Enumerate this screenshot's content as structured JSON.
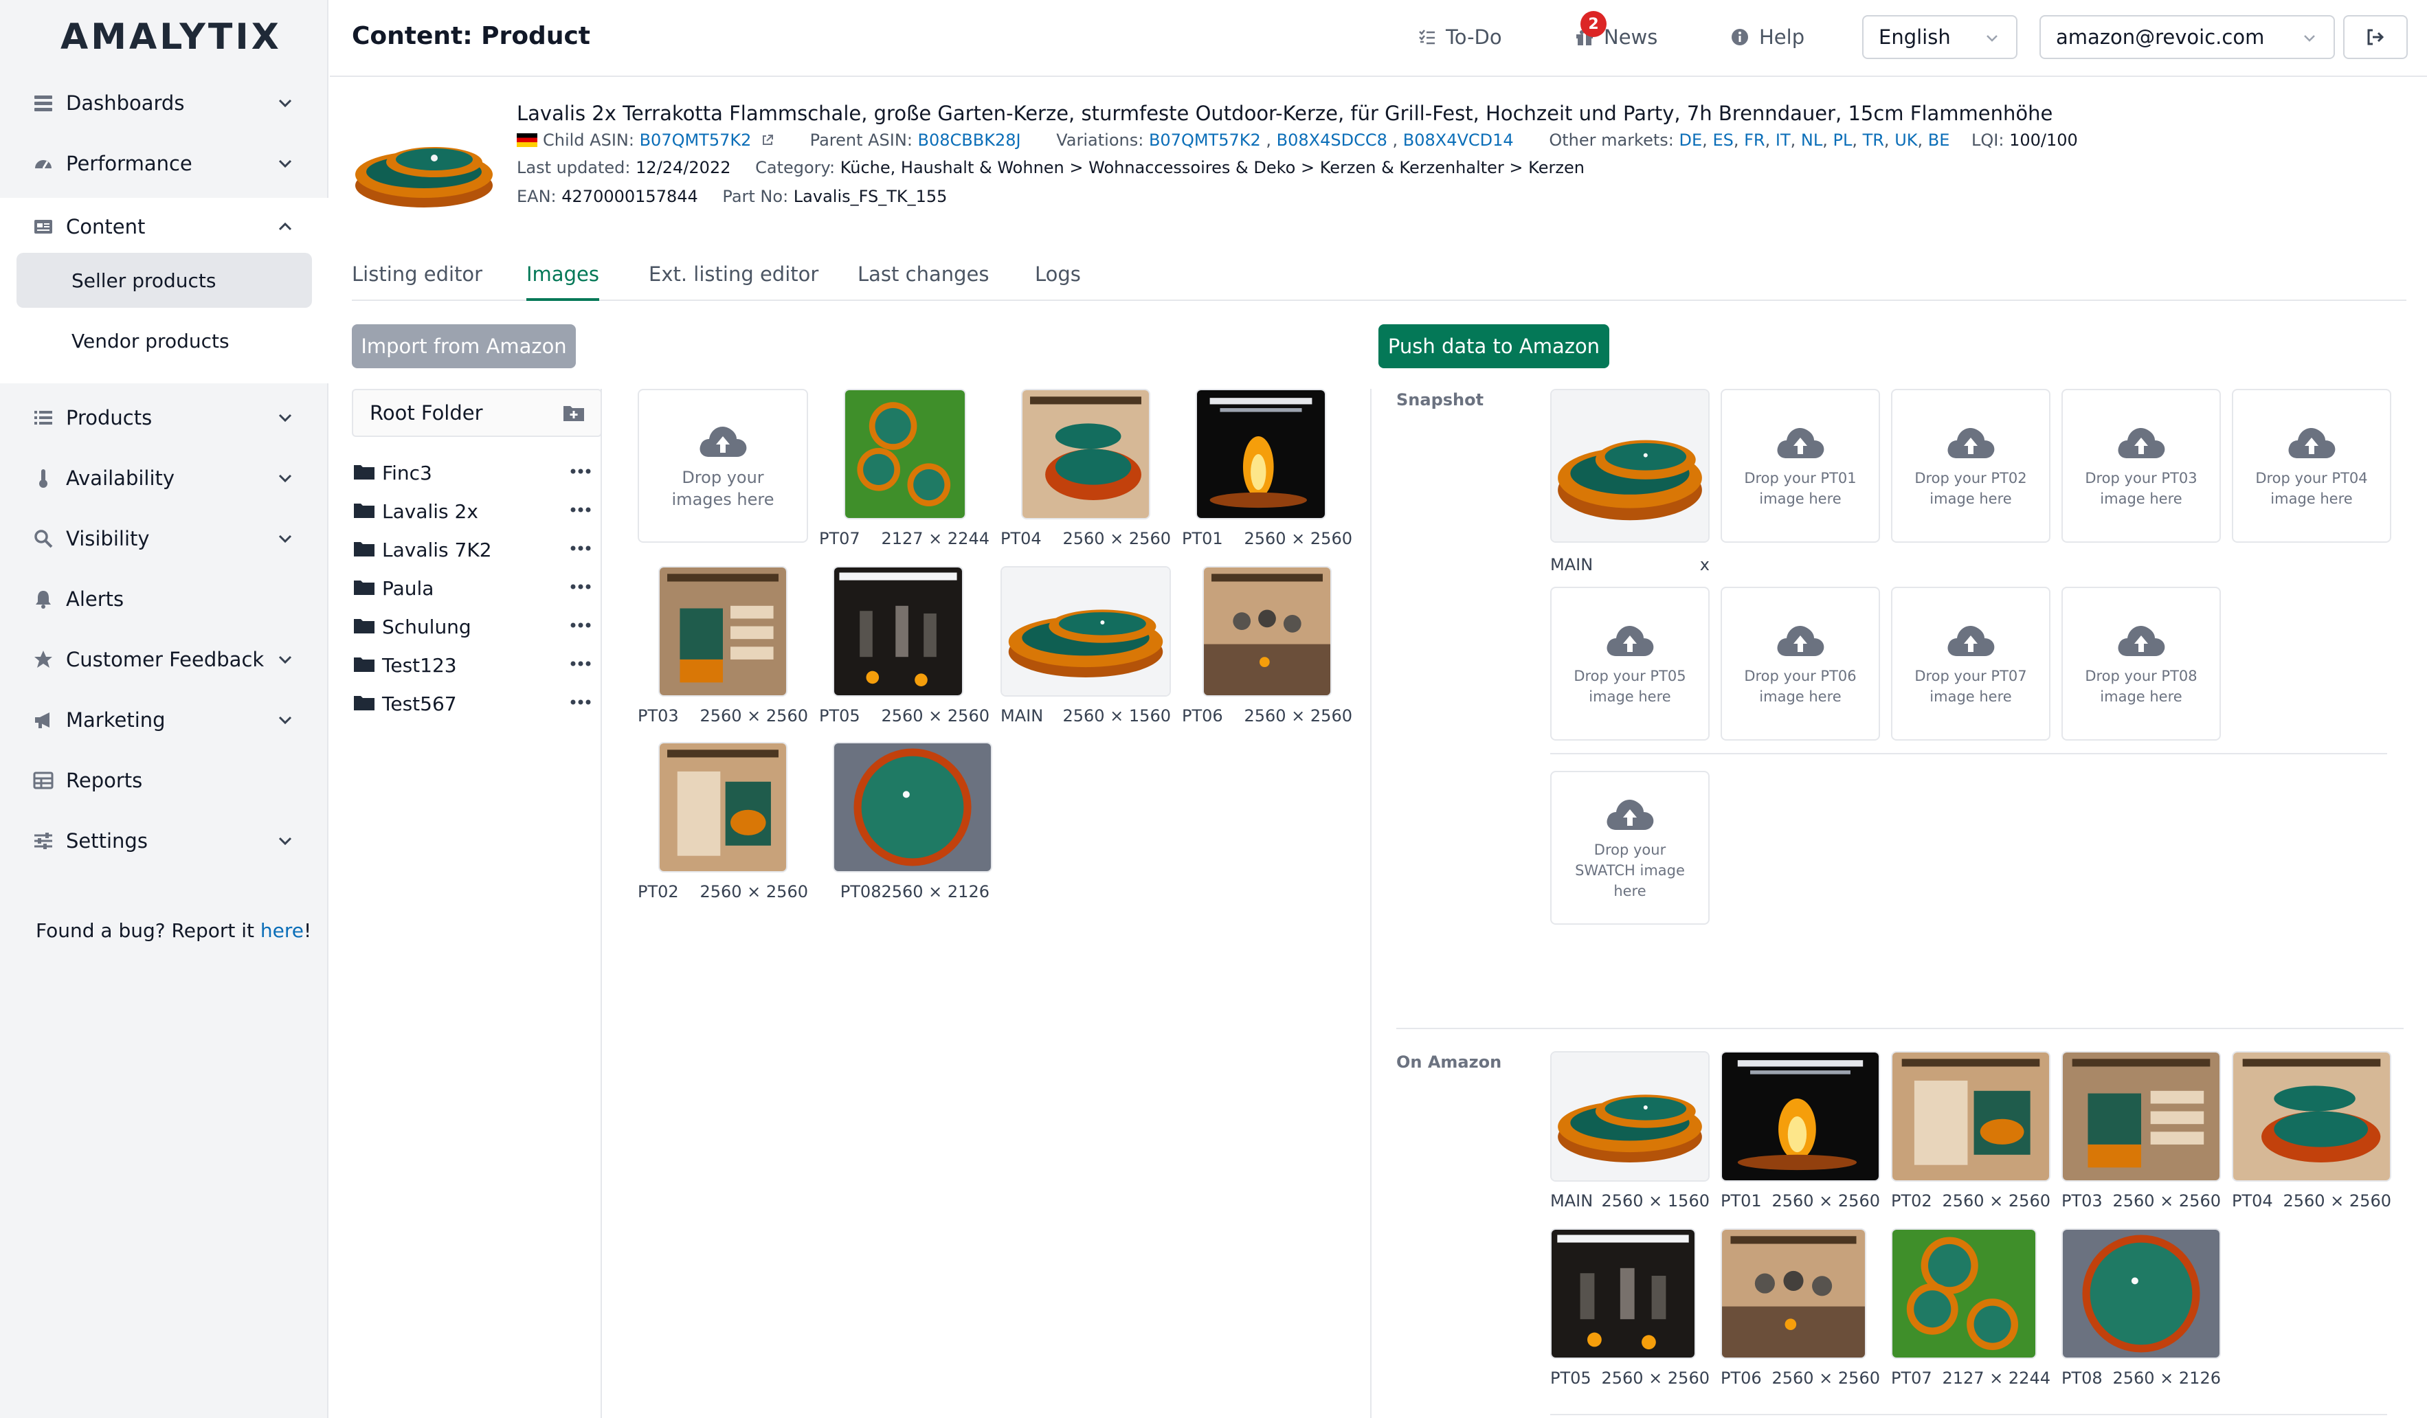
{
  "app": {
    "logo": "AMALYTIX"
  },
  "sidebar": {
    "items": [
      {
        "label": "Dashboards",
        "icon": "dashboard-icon"
      },
      {
        "label": "Performance",
        "icon": "speedometer-icon"
      },
      {
        "label": "Content",
        "icon": "content-icon"
      },
      {
        "label": "Products",
        "icon": "list-icon"
      },
      {
        "label": "Availability",
        "icon": "thermometer-icon"
      },
      {
        "label": "Visibility",
        "icon": "search-icon"
      },
      {
        "label": "Alerts",
        "icon": "bell-icon"
      },
      {
        "label": "Customer Feedback",
        "icon": "star-icon"
      },
      {
        "label": "Marketing",
        "icon": "megaphone-icon"
      },
      {
        "label": "Reports",
        "icon": "table-icon"
      },
      {
        "label": "Settings",
        "icon": "sliders-icon"
      }
    ],
    "content_sub": [
      "Seller products",
      "Vendor products"
    ],
    "bug_text": "Found a bug? Report it ",
    "bug_link": "here",
    "bug_end": "!"
  },
  "header": {
    "title": "Content: Product",
    "todo": "To-Do",
    "news": "News",
    "news_badge": "2",
    "help": "Help",
    "language": "English",
    "account": "amazon@revoic.com"
  },
  "product": {
    "title": "Lavalis 2x Terrakotta Flammschale, große Garten-Kerze, sturmfeste Outdoor-Kerze, für Grill-Fest, Hochzeit und Party, 7h Brenndauer, 15cm Flammenhöhe",
    "child_asin_label": "Child ASIN:",
    "child_asin": "B07QMT57K2",
    "parent_asin_label": "Parent ASIN:",
    "parent_asin": "B08CBBK28J",
    "variations_label": "Variations:",
    "variations": [
      "B07QMT57K2",
      "B08X4SDCC8",
      "B08X4VCD14"
    ],
    "other_markets_label": "Other markets:",
    "other_markets": [
      "DE",
      "ES",
      "FR",
      "IT",
      "NL",
      "PL",
      "TR",
      "UK",
      "BE"
    ],
    "lqi_label": "LQI:",
    "lqi": "100/100",
    "last_updated_label": "Last updated:",
    "last_updated": "12/24/2022",
    "category_label": "Category:",
    "category": "Küche, Haushalt & Wohnen > Wohnaccessoires & Deko > Kerzen & Kerzenhalter > Kerzen",
    "ean_label": "EAN:",
    "ean": "4270000157844",
    "part_no_label": "Part No:",
    "part_no": "Lavalis_FS_TK_155"
  },
  "tabs": [
    "Listing editor",
    "Images",
    "Ext. listing editor",
    "Last changes",
    "Logs"
  ],
  "buttons": {
    "import": "Import from Amazon",
    "push": "Push data to Amazon"
  },
  "folders": {
    "root": "Root Folder",
    "items": [
      "Finc3",
      "Lavalis 2x",
      "Lavalis 7K2",
      "Paula",
      "Schulung",
      "Test123",
      "Test567"
    ]
  },
  "library": {
    "drop_text": "Drop your images here",
    "images": [
      {
        "slot": "PT07",
        "size": "2127 × 2244"
      },
      {
        "slot": "PT04",
        "size": "2560 × 2560"
      },
      {
        "slot": "PT01",
        "size": "2560 × 2560"
      },
      {
        "slot": "PT03",
        "size": "2560 × 2560"
      },
      {
        "slot": "PT05",
        "size": "2560 × 2560"
      },
      {
        "slot": "MAIN",
        "size": "2560 × 1560"
      },
      {
        "slot": "PT06",
        "size": "2560 × 2560"
      },
      {
        "slot": "PT02",
        "size": "2560 × 2560"
      },
      {
        "slot": "PT08",
        "size": "2560 × 2126"
      }
    ]
  },
  "snapshot": {
    "label": "Snapshot",
    "main_label": "MAIN",
    "remove": "x",
    "drop_slots": [
      "Drop your PT01 image here",
      "Drop your PT02 image here",
      "Drop your PT03 image here",
      "Drop your PT04 image here",
      "Drop your PT05 image here",
      "Drop your PT06 image here",
      "Drop your PT07 image here",
      "Drop your PT08 image here"
    ],
    "swatch": "Drop your SWATCH image here"
  },
  "on_amazon": {
    "label": "On Amazon",
    "images": [
      {
        "slot": "MAIN",
        "size": "2560 × 1560"
      },
      {
        "slot": "PT01",
        "size": "2560 × 2560"
      },
      {
        "slot": "PT02",
        "size": "2560 × 2560"
      },
      {
        "slot": "PT03",
        "size": "2560 × 2560"
      },
      {
        "slot": "PT04",
        "size": "2560 × 2560"
      },
      {
        "slot": "PT05",
        "size": "2560 × 2560"
      },
      {
        "slot": "PT06",
        "size": "2560 × 2560"
      },
      {
        "slot": "PT07",
        "size": "2127 × 2244"
      },
      {
        "slot": "PT08",
        "size": "2560 × 2126"
      }
    ]
  },
  "colors": {
    "accent": "#047857",
    "link": "#0b6eb8",
    "badge": "#dc2626",
    "disabled": "#9ca3af"
  }
}
